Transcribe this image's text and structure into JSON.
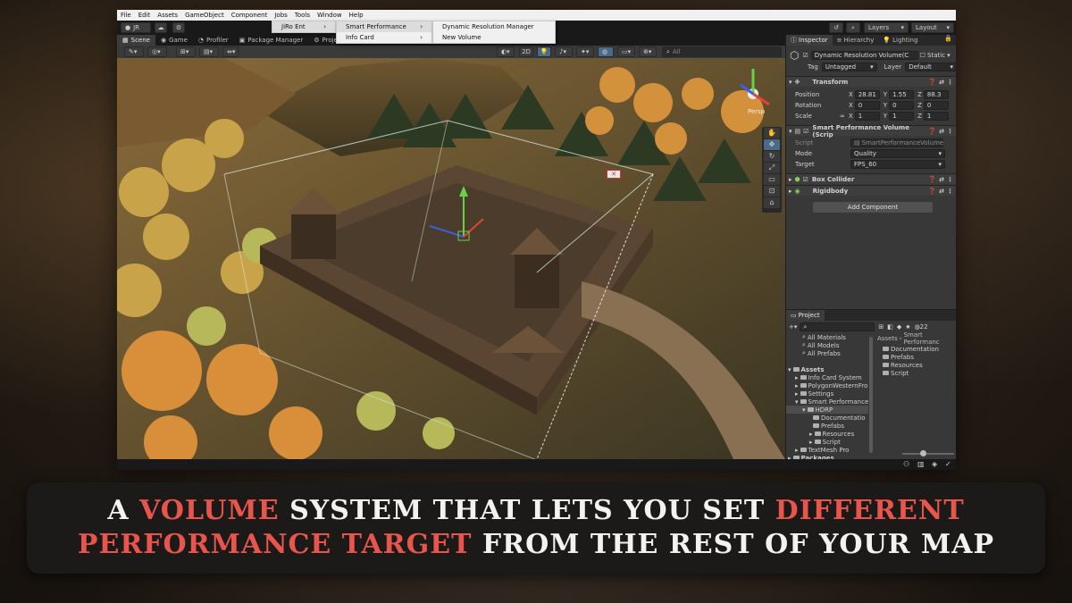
{
  "menubar": [
    "File",
    "Edit",
    "Assets",
    "GameObject",
    "Component",
    "Jobs",
    "Tools",
    "Window",
    "Help"
  ],
  "toolbar": {
    "account": "JR",
    "layers": "Layers",
    "layout": "Layout"
  },
  "tabs": [
    "Scene",
    "Game",
    "Profiler",
    "Package Manager",
    "Project"
  ],
  "menu_l1": {
    "item": "JiRo Ent"
  },
  "menu_l2": [
    "Smart Performance",
    "Info Card"
  ],
  "menu_l3": [
    "Dynamic Resolution Manager",
    "New Volume"
  ],
  "scene_toolbar": {
    "mode_2d": "2D",
    "search_placeholder": "All",
    "persp": "Persp"
  },
  "inspector": {
    "tabs": [
      "Inspector",
      "Hierarchy",
      "Lighting"
    ],
    "object_name": "Dynamic Resolution Volume(C",
    "static_label": "Static",
    "tag_label": "Tag",
    "tag_value": "Untagged",
    "layer_label": "Layer",
    "layer_value": "Default",
    "transform": {
      "title": "Transform",
      "position": {
        "label": "Position",
        "x": "28.81",
        "y": "1.55",
        "z": "88.3"
      },
      "rotation": {
        "label": "Rotation",
        "x": "0",
        "y": "0",
        "z": "0"
      },
      "scale": {
        "label": "Scale",
        "x": "1",
        "y": "1",
        "z": "1"
      }
    },
    "spv": {
      "title": "Smart Performance Volume (Scrip",
      "script_label": "Script",
      "script_value": "SmartPerformanceVolume",
      "mode_label": "Mode",
      "mode_value": "Quality",
      "target_label": "Target",
      "target_value": "FPS_60"
    },
    "box_collider": "Box Collider",
    "rigidbody": "Rigidbody",
    "add_component": "Add Component"
  },
  "project": {
    "title": "Project",
    "count": "22",
    "favorites": [
      "All Materials",
      "All Models",
      "All Prefabs"
    ],
    "assets_label": "Assets",
    "tree": [
      "Info Card System",
      "PolygonWesternFro",
      "Settings",
      "Smart Performance",
      "HDRP",
      "Documentatio",
      "Prefabs",
      "Resources",
      "Script",
      "TextMesh Pro"
    ],
    "packages_label": "Packages",
    "breadcrumb": [
      "Assets",
      "Smart Performanc"
    ],
    "content": [
      "Documentation",
      "Prefabs",
      "Resources",
      "Script"
    ]
  },
  "caption": {
    "l1_a": "A ",
    "l1_b": "VOLUME",
    "l1_c": " SYSTEM THAT LETS YOU SET ",
    "l1_d": "DIFFERENT",
    "l2_a": "PERFORMANCE TARGET",
    "l2_b": " FROM THE REST OF YOUR MAP"
  },
  "colors": {
    "accent_red": "#e8554d",
    "caption_bg": "#1c1a19",
    "editor_bg": "#282828"
  }
}
